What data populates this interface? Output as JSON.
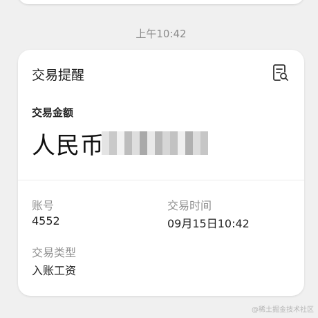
{
  "timestamp": "上午10:42",
  "card": {
    "title": "交易提醒",
    "icon": "document-search-icon",
    "amount_label": "交易金额",
    "amount_prefix": "人民币",
    "amount_masked": true,
    "fields": [
      {
        "label": "账号",
        "value": "4552"
      },
      {
        "label": "交易时间",
        "value": "09月15日10:42"
      },
      {
        "label": "交易类型",
        "value": "入账工资"
      }
    ]
  },
  "watermark": "@稀土掘金技术社区"
}
